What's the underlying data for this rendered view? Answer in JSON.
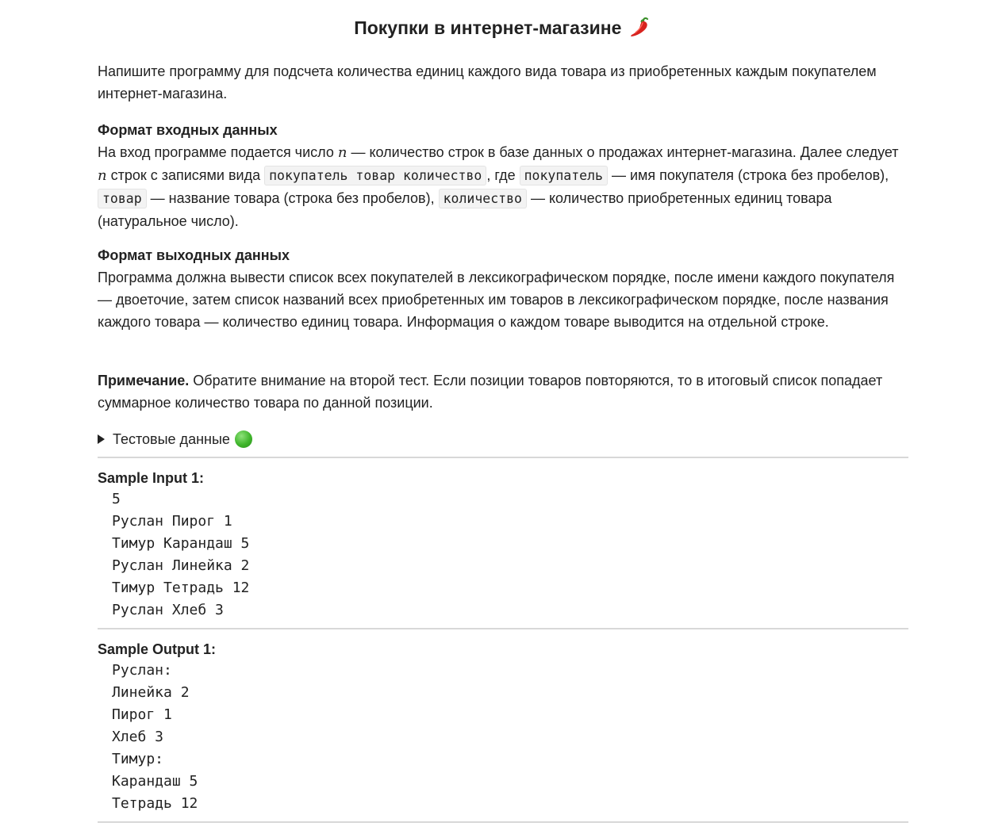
{
  "title": "Покупки в интернет-магазине",
  "intro": "Напишите программу для подсчета количества единиц каждого вида товара из приобретенных каждым покупателем интернет-магазина.",
  "input_format": {
    "heading": "Формат входных данных",
    "t1": "На вход программе подается число ",
    "var1": "n",
    "t2": " — количество строк в базе данных о продажах интернет-магазина. Далее следует ",
    "var2": "n",
    "t3": " строк с записями вида ",
    "code1": "покупатель товар количество",
    "t4": ", где ",
    "code2": "покупатель",
    "t5": " — имя покупателя (строка без пробелов), ",
    "code3": "товар",
    "t6": " — название товара (строка без пробелов), ",
    "code4": "количество",
    "t7": " — количество приобретенных единиц товара (натуральное число)."
  },
  "output_format": {
    "heading": "Формат выходных данных",
    "text": "Программа должна вывести список всех покупателей в лексикографическом порядке, после имени каждого покупателя — двоеточие, затем список названий всех приобретенных им товаров в лексикографическом порядке, после названия каждого товара — количество единиц товара. Информация о каждом товаре выводится на отдельной строке."
  },
  "note": {
    "label": "Примечание.",
    "text": " Обратите внимание на второй тест. Если позиции товаров повторяются, то в итоговый список попадает суммарное количество товара по данной позиции."
  },
  "details": {
    "label": "Тестовые данные",
    "icon": "green-circle-icon"
  },
  "sample_input": {
    "label": "Sample Input 1:",
    "lines": [
      "5",
      "Руслан Пирог 1",
      "Тимур Карандаш 5",
      "Руслан Линейка 2",
      "Тимур Тетрадь 12",
      "Руслан Хлеб 3"
    ]
  },
  "sample_output": {
    "label": "Sample Output 1:",
    "lines": [
      "Руслан:",
      "Линейка 2",
      "Пирог 1",
      "Хлеб 3",
      "Тимур:",
      "Карандаш 5",
      "Тетрадь 12"
    ]
  }
}
